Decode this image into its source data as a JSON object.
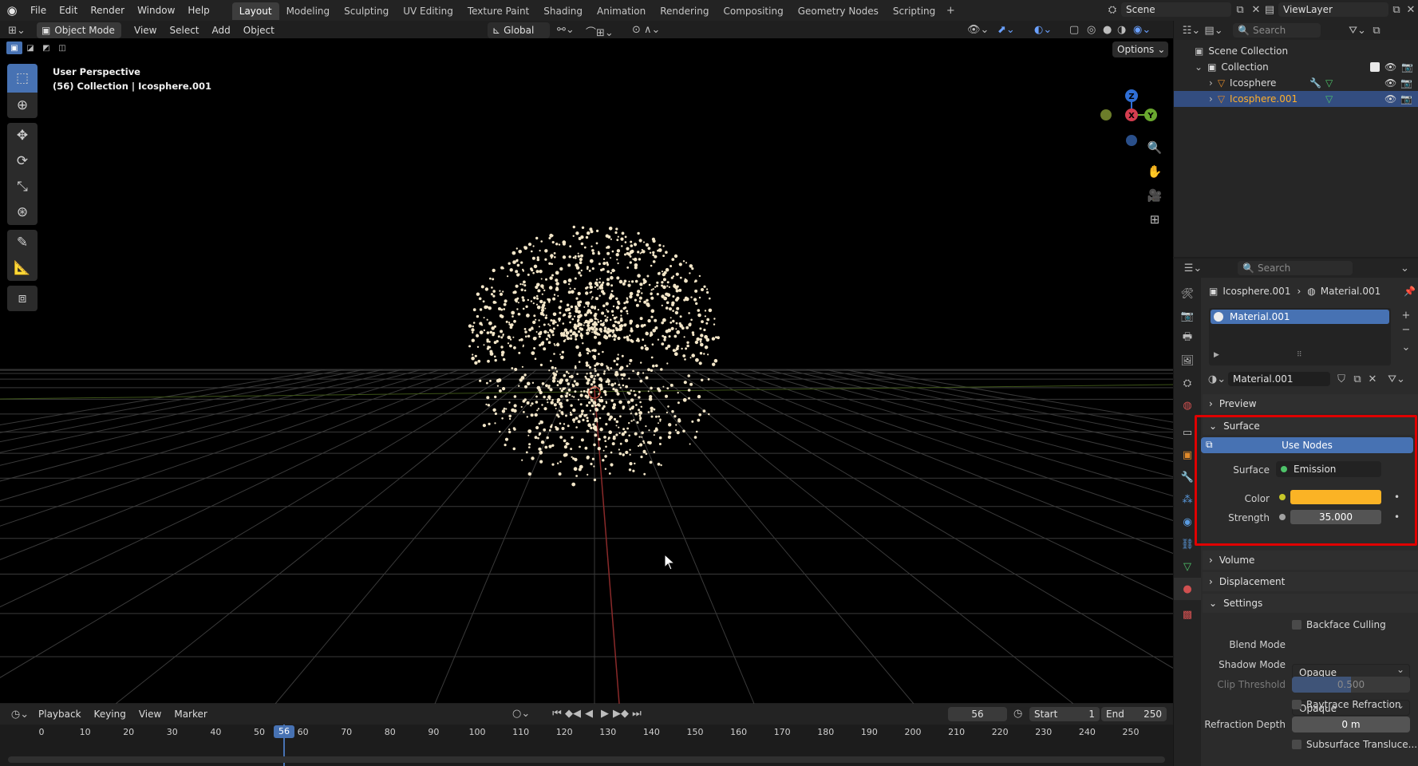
{
  "menu": [
    "File",
    "Edit",
    "Render",
    "Window",
    "Help"
  ],
  "workspaces": [
    {
      "label": "Layout",
      "active": true
    },
    {
      "label": "Modeling"
    },
    {
      "label": "Sculpting"
    },
    {
      "label": "UV Editing"
    },
    {
      "label": "Texture Paint"
    },
    {
      "label": "Shading"
    },
    {
      "label": "Animation"
    },
    {
      "label": "Rendering"
    },
    {
      "label": "Compositing"
    },
    {
      "label": "Geometry Nodes"
    },
    {
      "label": "Scripting"
    }
  ],
  "scene": "Scene",
  "view_layer": "ViewLayer",
  "viewport_header": {
    "mode": "Object Mode",
    "menus": [
      "View",
      "Select",
      "Add",
      "Object"
    ],
    "orientation": "Global",
    "options": "Options"
  },
  "viewport": {
    "perspective": "User Perspective",
    "collection": "(56) Collection | Icosphere.001",
    "gizmo": {
      "z": "Z",
      "x": "X",
      "y": "Y"
    }
  },
  "timeline": {
    "menus": [
      "Playback",
      "Keying",
      "View",
      "Marker"
    ],
    "current_frame": "56",
    "start_label": "Start",
    "start": "1",
    "end_label": "End",
    "end": "250",
    "ticks": [
      "0",
      "10",
      "20",
      "30",
      "40",
      "50",
      "60",
      "70",
      "80",
      "90",
      "100",
      "110",
      "120",
      "130",
      "140",
      "150",
      "160",
      "170",
      "180",
      "190",
      "200",
      "210",
      "220",
      "230",
      "240",
      "250"
    ],
    "playhead": "56"
  },
  "outliner": {
    "search_placeholder": "Search",
    "scene_collection": "Scene Collection",
    "collection": "Collection",
    "items": [
      {
        "name": "Icosphere",
        "selected": false
      },
      {
        "name": "Icosphere.001",
        "selected": true
      }
    ]
  },
  "properties": {
    "search_placeholder": "Search",
    "breadcrumb_object": "Icosphere.001",
    "breadcrumb_material": "Material.001",
    "slot": "Material.001",
    "material_name": "Material.001",
    "panels": {
      "preview": "Preview",
      "surface": "Surface",
      "use_nodes": "Use Nodes",
      "surface_label": "Surface",
      "surface_value": "Emission",
      "color_label": "Color",
      "strength_label": "Strength",
      "strength_value": "35.000",
      "volume": "Volume",
      "displacement": "Displacement",
      "settings": "Settings",
      "backface_culling": "Backface Culling",
      "blend_mode_label": "Blend Mode",
      "blend_mode": "Opaque",
      "shadow_mode_label": "Shadow Mode",
      "shadow_mode": "Opaque",
      "clip_threshold_label": "Clip Threshold",
      "clip_threshold": "0.500",
      "raytrace_refraction": "Raytrace Refraction",
      "refraction_depth_label": "Refraction Depth",
      "refraction_depth": "0 m",
      "subsurface": "Subsurface Transluce..."
    },
    "emission_color": "#fbb325"
  }
}
